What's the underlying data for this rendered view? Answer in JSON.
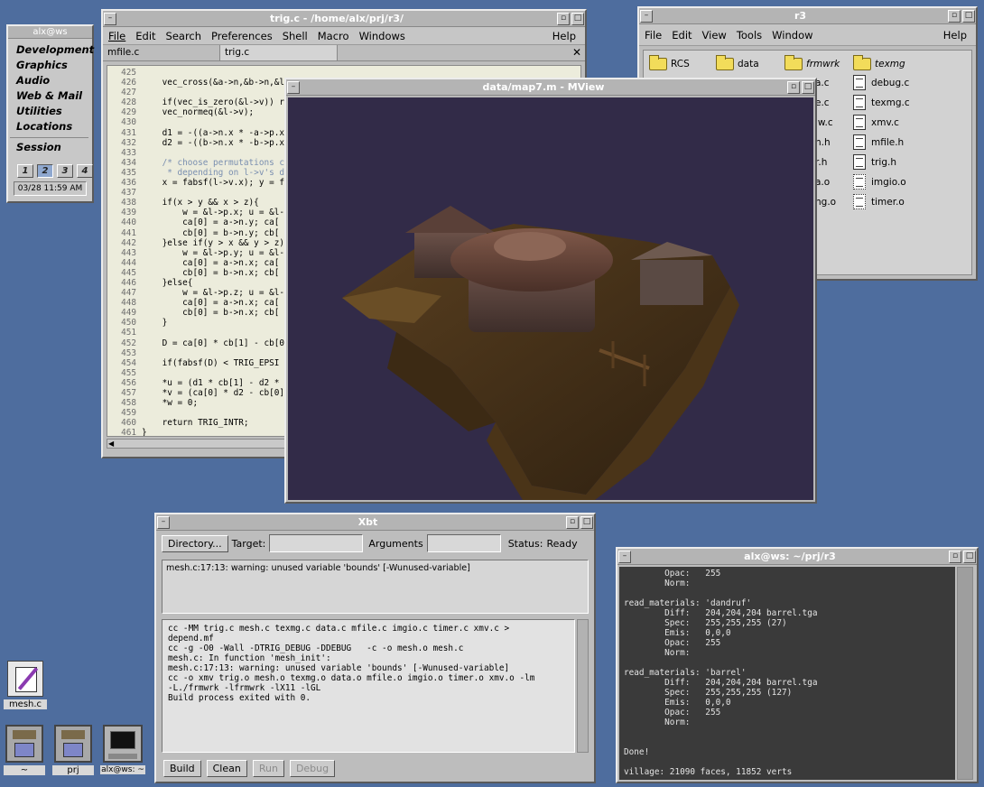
{
  "toolchest": {
    "title": "alx@ws",
    "items": [
      "Development",
      "Graphics",
      "Audio",
      "Web & Mail",
      "Utilities",
      "Locations"
    ],
    "session": "Session",
    "desks": [
      "1",
      "2",
      "3",
      "4"
    ],
    "active_desk": "2",
    "clock": "03/28 11:59 AM"
  },
  "editor": {
    "title": "trig.c - /home/alx/prj/r3/",
    "menu": [
      "File",
      "Edit",
      "Search",
      "Preferences",
      "Shell",
      "Macro",
      "Windows"
    ],
    "help": "Help",
    "tabs": [
      "mfile.c",
      "trig.c"
    ],
    "close_glyph": "✕",
    "line_numbers": "425\n426\n427\n428\n429\n430\n431\n432\n433\n434\n435\n436\n437\n438\n439\n440\n441\n442\n443\n444\n445\n446\n447\n448\n449\n450\n451\n452\n453\n454\n455\n456\n457\n458\n459\n460\n461",
    "code_lines": [
      {
        "t": "",
        "c": ""
      },
      {
        "t": "    vec_cross(&a->n,&b->n,&l",
        "c": ""
      },
      {
        "t": "",
        "c": ""
      },
      {
        "t": "    if(vec_is_zero(&l->v)) r",
        "c": ""
      },
      {
        "t": "    vec_normeq(&l->v);",
        "c": ""
      },
      {
        "t": "",
        "c": ""
      },
      {
        "t": "    d1 = -((a->n.x * -a->p.x",
        "c": ""
      },
      {
        "t": "    d2 = -((b->n.x * -b->p.x",
        "c": ""
      },
      {
        "t": "",
        "c": ""
      },
      {
        "t": "    /* choose permutations c",
        "c": "comment"
      },
      {
        "t": "     * depending on l->v's d",
        "c": "comment"
      },
      {
        "t": "    x = fabsf(l->v.x); y = f",
        "c": ""
      },
      {
        "t": "",
        "c": ""
      },
      {
        "t": "    if(x > y && x > z){",
        "c": ""
      },
      {
        "t": "        w = &l->p.x; u = &l-",
        "c": ""
      },
      {
        "t": "        ca[0] = a->n.y; ca[",
        "c": ""
      },
      {
        "t": "        cb[0] = b->n.y; cb[",
        "c": ""
      },
      {
        "t": "    }else if(y > x && y > z)",
        "c": ""
      },
      {
        "t": "        w = &l->p.y; u = &l-",
        "c": ""
      },
      {
        "t": "        ca[0] = a->n.x; ca[",
        "c": ""
      },
      {
        "t": "        cb[0] = b->n.x; cb[",
        "c": ""
      },
      {
        "t": "    }else{",
        "c": ""
      },
      {
        "t": "        w = &l->p.z; u = &l-",
        "c": ""
      },
      {
        "t": "        ca[0] = a->n.x; ca[",
        "c": ""
      },
      {
        "t": "        cb[0] = b->n.x; cb[",
        "c": ""
      },
      {
        "t": "    }",
        "c": ""
      },
      {
        "t": "",
        "c": ""
      },
      {
        "t": "    D = ca[0] * cb[1] - cb[0",
        "c": ""
      },
      {
        "t": "",
        "c": ""
      },
      {
        "t": "    if(fabsf(D) < TRIG_EPSI",
        "c": ""
      },
      {
        "t": "",
        "c": ""
      },
      {
        "t": "    *u = (d1 * cb[1] - d2 *",
        "c": ""
      },
      {
        "t": "    *v = (ca[0] * d2 - cb[0]",
        "c": ""
      },
      {
        "t": "    *w = 0;",
        "c": ""
      },
      {
        "t": "",
        "c": ""
      },
      {
        "t": "    return TRIG_INTR;",
        "c": ""
      },
      {
        "t": "}",
        "c": ""
      }
    ]
  },
  "filemanager": {
    "title": "r3",
    "menu": [
      "File",
      "Edit",
      "View",
      "Tools",
      "Window"
    ],
    "help": "Help",
    "folders": [
      "RCS",
      "data",
      "frmwrk",
      "texmg"
    ],
    "col1_files": [
      "a.c",
      "e.c",
      "lw.c",
      "h.h",
      "r.h",
      "a.o",
      "ng.o"
    ],
    "col2_files": [
      "debug.c",
      "texmg.c",
      "xmv.c",
      "mfile.h",
      "trig.h",
      "imgio.o",
      "timer.o"
    ]
  },
  "mview": {
    "title": "data/map7.m - MView"
  },
  "xbt": {
    "title": "Xbt",
    "directory_btn": "Directory...",
    "target_label": "Target:",
    "arguments_label": "Arguments",
    "status_label": "Status:",
    "status_value": "Ready",
    "warning": "mesh.c:17:13: warning: unused variable 'bounds' [-Wunused-variable]",
    "output": "cc -MM trig.c mesh.c texmg.c data.c mfile.c imgio.c timer.c xmv.c >\ndepend.mf\ncc -g -O0 -Wall -DTRIG_DEBUG -DDEBUG   -c -o mesh.o mesh.c\nmesh.c: In function 'mesh_init':\nmesh.c:17:13: warning: unused variable 'bounds' [-Wunused-variable]\ncc -o xmv trig.o mesh.o texmg.o data.o mfile.o imgio.o timer.o xmv.o -lm\n-L./frmwrk -lfrmwrk -lX11 -lGL\nBuild process exited with 0.",
    "buttons": {
      "build": "Build",
      "clean": "Clean",
      "run": "Run",
      "debug": "Debug"
    }
  },
  "terminal": {
    "title": "alx@ws: ~/prj/r3",
    "output": "        Opac:   255\n        Norm:\n\nread_materials: 'dandruf'\n        Diff:   204,204,204 barrel.tga\n        Spec:   255,255,255 (27)\n        Emis:   0,0,0\n        Opac:   255\n        Norm:\n\nread_materials: 'barrel'\n        Diff:   204,204,204 barrel.tga\n        Spec:   255,255,255 (127)\n        Emis:   0,0,0\n        Opac:   255\n        Norm:\n\n\nDone!\n\nvillage: 21090 faces, 11852 verts"
  },
  "desktop_icons": {
    "mesh": "mesh.c",
    "home": "~",
    "prj": "prj",
    "term": "alx@ws: ~"
  },
  "colors": {
    "desktop": "#4e6d9e",
    "comment": "#7a8fb0",
    "terminal_bg": "#3a3a3a",
    "terminal_fg": "#e4e4e4"
  }
}
